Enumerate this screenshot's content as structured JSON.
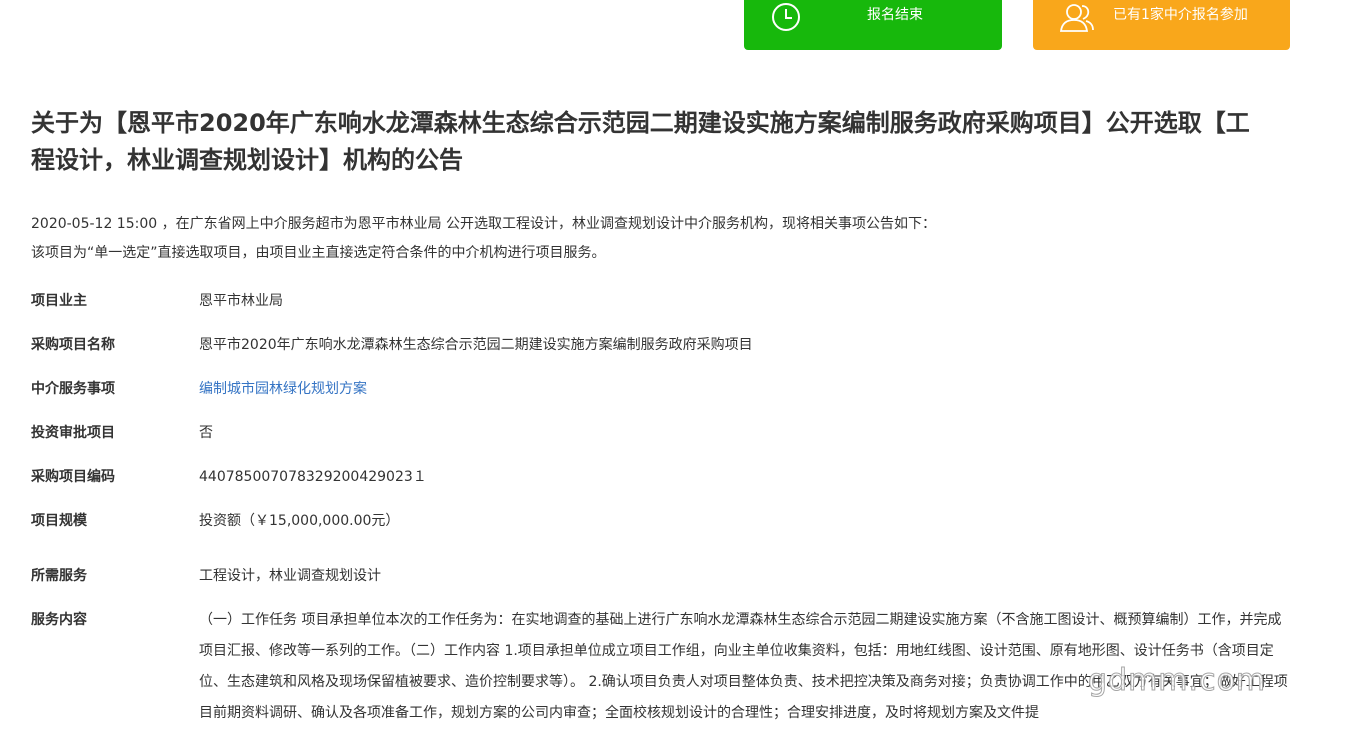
{
  "buttons": {
    "ended_label": "报名结束",
    "joined_label": "已有1家中介报名参加",
    "ended_color": "#17b80c",
    "joined_color": "#f9a71b"
  },
  "title": "关于为【恩平市2020年广东响水龙潭森林生态综合示范园二期建设实施方案编制服务政府采购项目】公开选取【工程设计，林业调查规划设计】机构的公告",
  "intro": {
    "line1": "2020-05-12 15:00 ，在广东省网上中介服务超市为恩平市林业局 公开选取工程设计，林业调查规划设计中介服务机构，现将相关事项公告如下：",
    "line2": "该项目为“单一选定”直接选取项目，由项目业主直接选定符合条件的中介机构进行项目服务。"
  },
  "fields": [
    {
      "key": "项目业主",
      "value": "恩平市林业局"
    },
    {
      "key": "采购项目名称",
      "value": "恩平市2020年广东响水龙潭森林生态综合示范园二期建设实施方案编制服务政府采购项目"
    },
    {
      "key": "中介服务事项",
      "value": "编制城市园林绿化规划方案"
    },
    {
      "key": "投资审批项目",
      "value": "否"
    },
    {
      "key": "采购项目编码",
      "value": "440785007078329200429023１"
    },
    {
      "key": "项目规模",
      "value": "投资额（￥15,000,000.00元）"
    },
    {
      "key": "所需服务",
      "value": "工程设计，林业调查规划设计"
    },
    {
      "key": "服务内容",
      "value": "（一）工作任务 项目承担单位本次的工作任务为：在实地调查的基础上进行广东响水龙潭森林生态综合示范园二期建设实施方案（不含施工图设计、概预算编制）工作，并完成项目汇报、修改等一系列的工作。（二）工作内容 1.项目承担单位成立项目工作组，向业主单位收集资料，包括：用地红线图、设计范围、原有地形图、设计任务书（含项目定位、生态建筑和风格及现场保留植被要求、造价控制要求等）。 2.确认项目负责人对项目整体负责、技术把控决策及商务对接；负责协调工作中的甲乙双方有关事宜；做好工程项目前期资料调研、确认及各项准备工作，规划方案的公司内审查；全面校核规划设计的合理性；合理安排进度，及时将规划方案及文件提"
    }
  ],
  "watermark": "gdmm.com"
}
